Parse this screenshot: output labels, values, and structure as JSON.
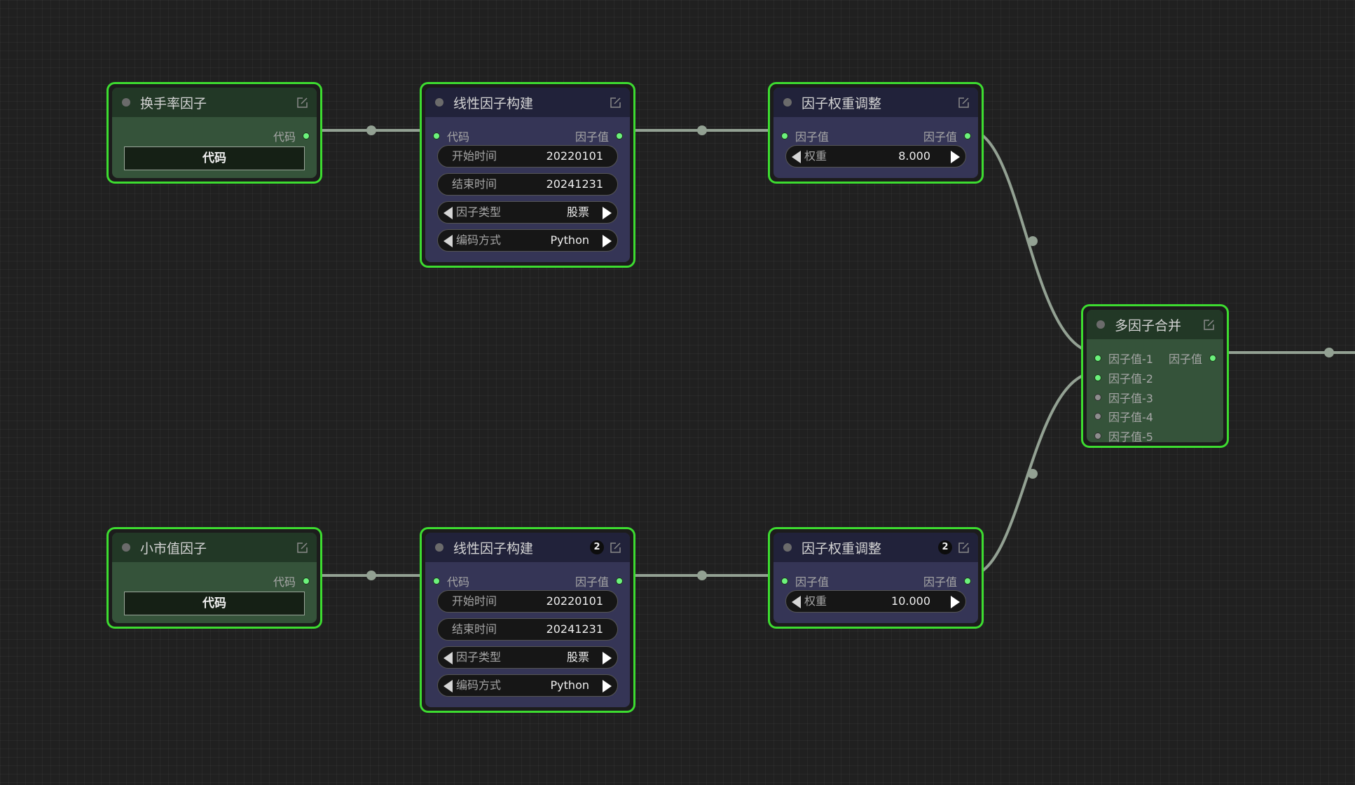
{
  "graph": {
    "nodes": {
      "turnover_factor": {
        "title": "换手率因子",
        "output_label": "代码",
        "button_label": "代码"
      },
      "small_cap_factor": {
        "title": "小市值因子",
        "output_label": "代码",
        "button_label": "代码"
      },
      "linear_build_1": {
        "title": "线性因子构建",
        "input_label": "代码",
        "output_label": "因子值",
        "start_label": "开始时间",
        "start_value": "20220101",
        "end_label": "结束时间",
        "end_value": "20241231",
        "type_label": "因子类型",
        "type_value": "股票",
        "encoding_label": "编码方式",
        "encoding_value": "Python"
      },
      "linear_build_2": {
        "title": "线性因子构建",
        "badge": "2",
        "input_label": "代码",
        "output_label": "因子值",
        "start_label": "开始时间",
        "start_value": "20220101",
        "end_label": "结束时间",
        "end_value": "20241231",
        "type_label": "因子类型",
        "type_value": "股票",
        "encoding_label": "编码方式",
        "encoding_value": "Python"
      },
      "weight_adjust_1": {
        "title": "因子权重调整",
        "input_label": "因子值",
        "output_label": "因子值",
        "weight_label": "权重",
        "weight_value": "8.000"
      },
      "weight_adjust_2": {
        "title": "因子权重调整",
        "badge": "2",
        "input_label": "因子值",
        "output_label": "因子值",
        "weight_label": "权重",
        "weight_value": "10.000"
      },
      "multi_merge": {
        "title": "多因子合并",
        "output_label": "因子值",
        "inputs": [
          "因子值-1",
          "因子值-2",
          "因子值-3",
          "因子值-4",
          "因子值-5"
        ]
      }
    },
    "icons": {
      "edit": "edit-icon",
      "status": "status-dot-icon"
    },
    "colors": {
      "canvas": "#202020",
      "node_border": "#3ddc30",
      "slot_connected": "#6cf27c",
      "link": "#93a193"
    }
  }
}
